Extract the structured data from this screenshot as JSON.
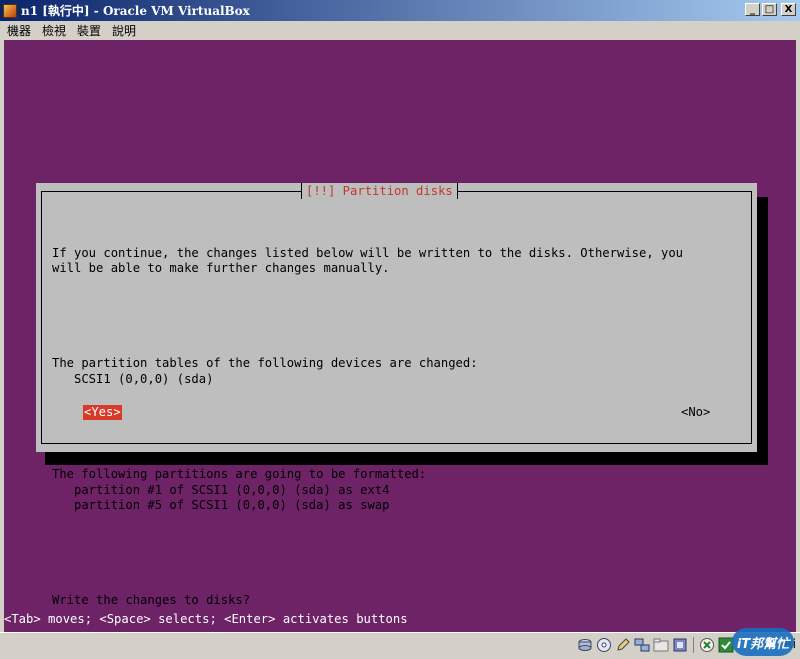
{
  "window": {
    "title": "n1 [執行中] - Oracle VM VirtualBox",
    "minimize_glyph": "_",
    "maximize_glyph": "□",
    "close_glyph": "X"
  },
  "menu": [
    "機器",
    "檢視",
    "裝置",
    "說明"
  ],
  "installer": {
    "dialog_title": "[!!] Partition disks",
    "paragraph1": "If you continue, the changes listed below will be written to the disks. Otherwise, you\nwill be able to make further changes manually.",
    "paragraph2": "The partition tables of the following devices are changed:\n   SCSI1 (0,0,0) (sda)",
    "paragraph3": "The following partitions are going to be formatted:\n   partition #1 of SCSI1 (0,0,0) (sda) as ext4\n   partition #5 of SCSI1 (0,0,0) (sda) as swap",
    "question": "Write the changes to disks?",
    "yes_button": "<Yes>",
    "no_button": "<No>",
    "help_line": "<Tab> moves; <Space> selects; <Enter> activates buttons"
  },
  "statusbar": {
    "icons": [
      "hard-disk-icon",
      "optical-drive-icon",
      "pencil-icon",
      "network-icon",
      "shared-folder-icon",
      "video-capture-icon",
      "mouse-integration-icon",
      "keyboard-capture-icon"
    ],
    "host_key": "Ri",
    "watermark": "iT邦幫忙"
  },
  "colors": {
    "vm_background": "#6e2367",
    "dialog_background": "#bebebe",
    "title_text": "#c0392b",
    "selected_button": "#d83a2a"
  }
}
